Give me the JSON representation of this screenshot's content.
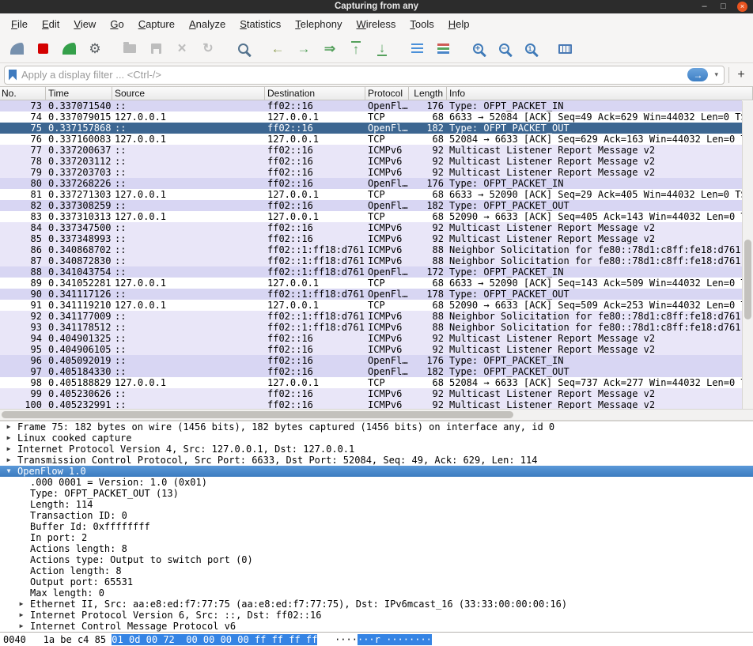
{
  "window": {
    "title": "Capturing from any",
    "controls": {
      "minimize": "–",
      "maximize": "□",
      "close": "×"
    }
  },
  "menu": {
    "items": [
      "File",
      "Edit",
      "View",
      "Go",
      "Capture",
      "Analyze",
      "Statistics",
      "Telephony",
      "Wireless",
      "Tools",
      "Help"
    ]
  },
  "toolbar": {
    "buttons": [
      "start-capture",
      "stop-capture",
      "restart-capture",
      "capture-options",
      "open-file",
      "save-file",
      "close-file",
      "reload",
      "find-packet",
      "go-back",
      "go-forward",
      "go-to-packet",
      "go-to-top",
      "go-to-bottom",
      "auto-scroll",
      "colorize",
      "zoom-in",
      "zoom-out",
      "zoom-original",
      "resize-columns"
    ],
    "separators_after": [
      3,
      7,
      8,
      13,
      15,
      18
    ]
  },
  "filter": {
    "placeholder": "Apply a display filter ... <Ctrl-/>",
    "add_label": "+"
  },
  "packet_list": {
    "columns": [
      "No.",
      "Time",
      "Source",
      "Destination",
      "Protocol",
      "Length",
      "Info"
    ],
    "selected_no": "75",
    "rows": [
      {
        "no": "73",
        "time": "0.337071540",
        "src": "::",
        "dst": "ff02::16",
        "proto": "OpenFl…",
        "len": "176",
        "info": "Type: OFPT_PACKET_IN",
        "type": "openflow"
      },
      {
        "no": "74",
        "time": "0.337079015",
        "src": "127.0.0.1",
        "dst": "127.0.0.1",
        "proto": "TCP",
        "len": "68",
        "info": "6633 → 52084 [ACK] Seq=49 Ack=629 Win=44032 Len=0 TS",
        "type": "tcp"
      },
      {
        "no": "75",
        "time": "0.337157868",
        "src": "::",
        "dst": "ff02::16",
        "proto": "OpenFl…",
        "len": "182",
        "info": "Type: OFPT_PACKET_OUT",
        "type": "openflow"
      },
      {
        "no": "76",
        "time": "0.337160083",
        "src": "127.0.0.1",
        "dst": "127.0.0.1",
        "proto": "TCP",
        "len": "68",
        "info": "52084 → 6633 [ACK] Seq=629 Ack=163 Win=44032 Len=0 T",
        "type": "tcp"
      },
      {
        "no": "77",
        "time": "0.337200637",
        "src": "::",
        "dst": "ff02::16",
        "proto": "ICMPv6",
        "len": "92",
        "info": "Multicast Listener Report Message v2",
        "type": "icmpv6"
      },
      {
        "no": "78",
        "time": "0.337203112",
        "src": "::",
        "dst": "ff02::16",
        "proto": "ICMPv6",
        "len": "92",
        "info": "Multicast Listener Report Message v2",
        "type": "icmpv6"
      },
      {
        "no": "79",
        "time": "0.337203703",
        "src": "::",
        "dst": "ff02::16",
        "proto": "ICMPv6",
        "len": "92",
        "info": "Multicast Listener Report Message v2",
        "type": "icmpv6"
      },
      {
        "no": "80",
        "time": "0.337268226",
        "src": "::",
        "dst": "ff02::16",
        "proto": "OpenFl…",
        "len": "176",
        "info": "Type: OFPT_PACKET_IN",
        "type": "openflow"
      },
      {
        "no": "81",
        "time": "0.337271303",
        "src": "127.0.0.1",
        "dst": "127.0.0.1",
        "proto": "TCP",
        "len": "68",
        "info": "6633 → 52090 [ACK] Seq=29 Ack=405 Win=44032 Len=0 TS",
        "type": "tcp"
      },
      {
        "no": "82",
        "time": "0.337308259",
        "src": "::",
        "dst": "ff02::16",
        "proto": "OpenFl…",
        "len": "182",
        "info": "Type: OFPT_PACKET_OUT",
        "type": "openflow"
      },
      {
        "no": "83",
        "time": "0.337310313",
        "src": "127.0.0.1",
        "dst": "127.0.0.1",
        "proto": "TCP",
        "len": "68",
        "info": "52090 → 6633 [ACK] Seq=405 Ack=143 Win=44032 Len=0 T",
        "type": "tcp"
      },
      {
        "no": "84",
        "time": "0.337347500",
        "src": "::",
        "dst": "ff02::16",
        "proto": "ICMPv6",
        "len": "92",
        "info": "Multicast Listener Report Message v2",
        "type": "icmpv6"
      },
      {
        "no": "85",
        "time": "0.337348993",
        "src": "::",
        "dst": "ff02::16",
        "proto": "ICMPv6",
        "len": "92",
        "info": "Multicast Listener Report Message v2",
        "type": "icmpv6"
      },
      {
        "no": "86",
        "time": "0.340868702",
        "src": "::",
        "dst": "ff02::1:ff18:d761",
        "proto": "ICMPv6",
        "len": "88",
        "info": "Neighbor Solicitation for fe80::78d1:c8ff:fe18:d761",
        "type": "icmpv6"
      },
      {
        "no": "87",
        "time": "0.340872830",
        "src": "::",
        "dst": "ff02::1:ff18:d761",
        "proto": "ICMPv6",
        "len": "88",
        "info": "Neighbor Solicitation for fe80::78d1:c8ff:fe18:d761",
        "type": "icmpv6"
      },
      {
        "no": "88",
        "time": "0.341043754",
        "src": "::",
        "dst": "ff02::1:ff18:d761",
        "proto": "OpenFl…",
        "len": "172",
        "info": "Type: OFPT_PACKET_IN",
        "type": "openflow"
      },
      {
        "no": "89",
        "time": "0.341052281",
        "src": "127.0.0.1",
        "dst": "127.0.0.1",
        "proto": "TCP",
        "len": "68",
        "info": "6633 → 52090 [ACK] Seq=143 Ack=509 Win=44032 Len=0 T",
        "type": "tcp"
      },
      {
        "no": "90",
        "time": "0.341117126",
        "src": "::",
        "dst": "ff02::1:ff18:d761",
        "proto": "OpenFl…",
        "len": "178",
        "info": "Type: OFPT_PACKET_OUT",
        "type": "openflow"
      },
      {
        "no": "91",
        "time": "0.341119210",
        "src": "127.0.0.1",
        "dst": "127.0.0.1",
        "proto": "TCP",
        "len": "68",
        "info": "52090 → 6633 [ACK] Seq=509 Ack=253 Win=44032 Len=0 T",
        "type": "tcp"
      },
      {
        "no": "92",
        "time": "0.341177009",
        "src": "::",
        "dst": "ff02::1:ff18:d761",
        "proto": "ICMPv6",
        "len": "88",
        "info": "Neighbor Solicitation for fe80::78d1:c8ff:fe18:d761",
        "type": "icmpv6"
      },
      {
        "no": "93",
        "time": "0.341178512",
        "src": "::",
        "dst": "ff02::1:ff18:d761",
        "proto": "ICMPv6",
        "len": "88",
        "info": "Neighbor Solicitation for fe80::78d1:c8ff:fe18:d761",
        "type": "icmpv6"
      },
      {
        "no": "94",
        "time": "0.404901325",
        "src": "::",
        "dst": "ff02::16",
        "proto": "ICMPv6",
        "len": "92",
        "info": "Multicast Listener Report Message v2",
        "type": "icmpv6"
      },
      {
        "no": "95",
        "time": "0.404906105",
        "src": "::",
        "dst": "ff02::16",
        "proto": "ICMPv6",
        "len": "92",
        "info": "Multicast Listener Report Message v2",
        "type": "icmpv6"
      },
      {
        "no": "96",
        "time": "0.405092019",
        "src": "::",
        "dst": "ff02::16",
        "proto": "OpenFl…",
        "len": "176",
        "info": "Type: OFPT_PACKET_IN",
        "type": "openflow"
      },
      {
        "no": "97",
        "time": "0.405184330",
        "src": "::",
        "dst": "ff02::16",
        "proto": "OpenFl…",
        "len": "182",
        "info": "Type: OFPT_PACKET_OUT",
        "type": "openflow"
      },
      {
        "no": "98",
        "time": "0.405188829",
        "src": "127.0.0.1",
        "dst": "127.0.0.1",
        "proto": "TCP",
        "len": "68",
        "info": "52084 → 6633 [ACK] Seq=737 Ack=277 Win=44032 Len=0 T",
        "type": "tcp"
      },
      {
        "no": "99",
        "time": "0.405230626",
        "src": "::",
        "dst": "ff02::16",
        "proto": "ICMPv6",
        "len": "92",
        "info": "Multicast Listener Report Message v2",
        "type": "icmpv6"
      },
      {
        "no": "100",
        "time": "0.405232991",
        "src": "::",
        "dst": "ff02::16",
        "proto": "ICMPv6",
        "len": "92",
        "info": "Multicast Listener Report Message v2",
        "type": "icmpv6"
      }
    ]
  },
  "details": {
    "rows": [
      {
        "arrow": "▶",
        "level": 0,
        "text": "Frame 75: 182 bytes on wire (1456 bits), 182 bytes captured (1456 bits) on interface any, id 0"
      },
      {
        "arrow": "▶",
        "level": 0,
        "text": "Linux cooked capture"
      },
      {
        "arrow": "▶",
        "level": 0,
        "text": "Internet Protocol Version 4, Src: 127.0.0.1, Dst: 127.0.0.1"
      },
      {
        "arrow": "▶",
        "level": 0,
        "text": "Transmission Control Protocol, Src Port: 6633, Dst Port: 52084, Seq: 49, Ack: 629, Len: 114"
      },
      {
        "arrow": "▼",
        "level": 0,
        "text": "OpenFlow 1.0",
        "selected": true
      },
      {
        "level": 1,
        "text": ".000 0001 = Version: 1.0 (0x01)"
      },
      {
        "level": 1,
        "text": "Type: OFPT_PACKET_OUT (13)"
      },
      {
        "level": 1,
        "text": "Length: 114"
      },
      {
        "level": 1,
        "text": "Transaction ID: 0"
      },
      {
        "level": 1,
        "text": "Buffer Id: 0xffffffff"
      },
      {
        "level": 1,
        "text": "In port: 2"
      },
      {
        "level": 1,
        "text": "Actions length: 8"
      },
      {
        "level": 1,
        "text": "Actions type: Output to switch port (0)"
      },
      {
        "level": 1,
        "text": "Action length: 8"
      },
      {
        "level": 1,
        "text": "Output port: 65531"
      },
      {
        "level": 1,
        "text": "Max length: 0"
      },
      {
        "arrow": "▶",
        "level": 1,
        "text": "Ethernet II, Src: aa:e8:ed:f7:77:75 (aa:e8:ed:f7:77:75), Dst: IPv6mcast_16 (33:33:00:00:00:16)"
      },
      {
        "arrow": "▶",
        "level": 1,
        "text": "Internet Protocol Version 6, Src: ::, Dst: ff02::16"
      },
      {
        "arrow": "▶",
        "level": 1,
        "text": "Internet Control Message Protocol v6"
      }
    ]
  },
  "hex": {
    "offset": "0040",
    "gap1": "   ",
    "plain": "1a be c4 85 ",
    "selected": "01 0d 00 72  00 00 00 00 ff ff ff ff",
    "gap2": "   ",
    "ascii_plain": "····",
    "ascii_selected": "···r ········"
  },
  "colors": {
    "accent_blue": "#3584e4",
    "selected_row": "#3c6691",
    "openflow_row": "#d8d6f3",
    "icmpv6_row": "#e9e6f8",
    "tcp_row": "#ffffff",
    "close_button": "#e95420",
    "detail_selected": "#4789cc"
  }
}
